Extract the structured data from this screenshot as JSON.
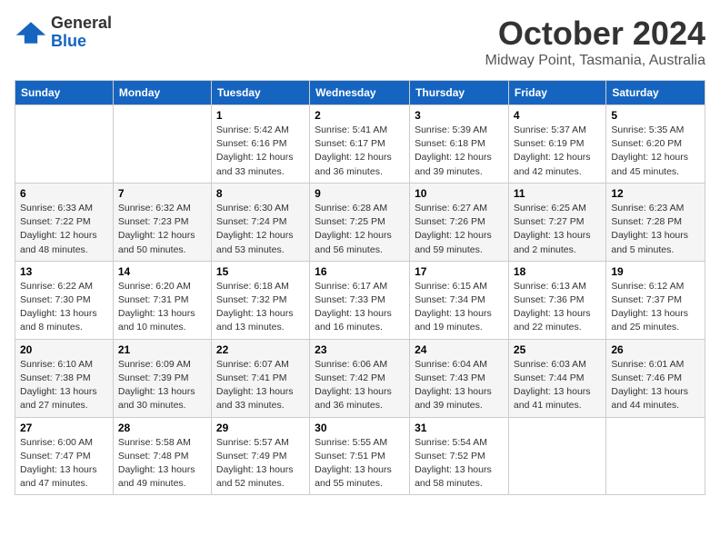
{
  "logo": {
    "line1": "General",
    "line2": "Blue"
  },
  "header": {
    "month": "October 2024",
    "location": "Midway Point, Tasmania, Australia"
  },
  "weekdays": [
    "Sunday",
    "Monday",
    "Tuesday",
    "Wednesday",
    "Thursday",
    "Friday",
    "Saturday"
  ],
  "weeks": [
    [
      {
        "day": "",
        "detail": ""
      },
      {
        "day": "",
        "detail": ""
      },
      {
        "day": "1",
        "detail": "Sunrise: 5:42 AM\nSunset: 6:16 PM\nDaylight: 12 hours\nand 33 minutes."
      },
      {
        "day": "2",
        "detail": "Sunrise: 5:41 AM\nSunset: 6:17 PM\nDaylight: 12 hours\nand 36 minutes."
      },
      {
        "day": "3",
        "detail": "Sunrise: 5:39 AM\nSunset: 6:18 PM\nDaylight: 12 hours\nand 39 minutes."
      },
      {
        "day": "4",
        "detail": "Sunrise: 5:37 AM\nSunset: 6:19 PM\nDaylight: 12 hours\nand 42 minutes."
      },
      {
        "day": "5",
        "detail": "Sunrise: 5:35 AM\nSunset: 6:20 PM\nDaylight: 12 hours\nand 45 minutes."
      }
    ],
    [
      {
        "day": "6",
        "detail": "Sunrise: 6:33 AM\nSunset: 7:22 PM\nDaylight: 12 hours\nand 48 minutes."
      },
      {
        "day": "7",
        "detail": "Sunrise: 6:32 AM\nSunset: 7:23 PM\nDaylight: 12 hours\nand 50 minutes."
      },
      {
        "day": "8",
        "detail": "Sunrise: 6:30 AM\nSunset: 7:24 PM\nDaylight: 12 hours\nand 53 minutes."
      },
      {
        "day": "9",
        "detail": "Sunrise: 6:28 AM\nSunset: 7:25 PM\nDaylight: 12 hours\nand 56 minutes."
      },
      {
        "day": "10",
        "detail": "Sunrise: 6:27 AM\nSunset: 7:26 PM\nDaylight: 12 hours\nand 59 minutes."
      },
      {
        "day": "11",
        "detail": "Sunrise: 6:25 AM\nSunset: 7:27 PM\nDaylight: 13 hours\nand 2 minutes."
      },
      {
        "day": "12",
        "detail": "Sunrise: 6:23 AM\nSunset: 7:28 PM\nDaylight: 13 hours\nand 5 minutes."
      }
    ],
    [
      {
        "day": "13",
        "detail": "Sunrise: 6:22 AM\nSunset: 7:30 PM\nDaylight: 13 hours\nand 8 minutes."
      },
      {
        "day": "14",
        "detail": "Sunrise: 6:20 AM\nSunset: 7:31 PM\nDaylight: 13 hours\nand 10 minutes."
      },
      {
        "day": "15",
        "detail": "Sunrise: 6:18 AM\nSunset: 7:32 PM\nDaylight: 13 hours\nand 13 minutes."
      },
      {
        "day": "16",
        "detail": "Sunrise: 6:17 AM\nSunset: 7:33 PM\nDaylight: 13 hours\nand 16 minutes."
      },
      {
        "day": "17",
        "detail": "Sunrise: 6:15 AM\nSunset: 7:34 PM\nDaylight: 13 hours\nand 19 minutes."
      },
      {
        "day": "18",
        "detail": "Sunrise: 6:13 AM\nSunset: 7:36 PM\nDaylight: 13 hours\nand 22 minutes."
      },
      {
        "day": "19",
        "detail": "Sunrise: 6:12 AM\nSunset: 7:37 PM\nDaylight: 13 hours\nand 25 minutes."
      }
    ],
    [
      {
        "day": "20",
        "detail": "Sunrise: 6:10 AM\nSunset: 7:38 PM\nDaylight: 13 hours\nand 27 minutes."
      },
      {
        "day": "21",
        "detail": "Sunrise: 6:09 AM\nSunset: 7:39 PM\nDaylight: 13 hours\nand 30 minutes."
      },
      {
        "day": "22",
        "detail": "Sunrise: 6:07 AM\nSunset: 7:41 PM\nDaylight: 13 hours\nand 33 minutes."
      },
      {
        "day": "23",
        "detail": "Sunrise: 6:06 AM\nSunset: 7:42 PM\nDaylight: 13 hours\nand 36 minutes."
      },
      {
        "day": "24",
        "detail": "Sunrise: 6:04 AM\nSunset: 7:43 PM\nDaylight: 13 hours\nand 39 minutes."
      },
      {
        "day": "25",
        "detail": "Sunrise: 6:03 AM\nSunset: 7:44 PM\nDaylight: 13 hours\nand 41 minutes."
      },
      {
        "day": "26",
        "detail": "Sunrise: 6:01 AM\nSunset: 7:46 PM\nDaylight: 13 hours\nand 44 minutes."
      }
    ],
    [
      {
        "day": "27",
        "detail": "Sunrise: 6:00 AM\nSunset: 7:47 PM\nDaylight: 13 hours\nand 47 minutes."
      },
      {
        "day": "28",
        "detail": "Sunrise: 5:58 AM\nSunset: 7:48 PM\nDaylight: 13 hours\nand 49 minutes."
      },
      {
        "day": "29",
        "detail": "Sunrise: 5:57 AM\nSunset: 7:49 PM\nDaylight: 13 hours\nand 52 minutes."
      },
      {
        "day": "30",
        "detail": "Sunrise: 5:55 AM\nSunset: 7:51 PM\nDaylight: 13 hours\nand 55 minutes."
      },
      {
        "day": "31",
        "detail": "Sunrise: 5:54 AM\nSunset: 7:52 PM\nDaylight: 13 hours\nand 58 minutes."
      },
      {
        "day": "",
        "detail": ""
      },
      {
        "day": "",
        "detail": ""
      }
    ]
  ]
}
